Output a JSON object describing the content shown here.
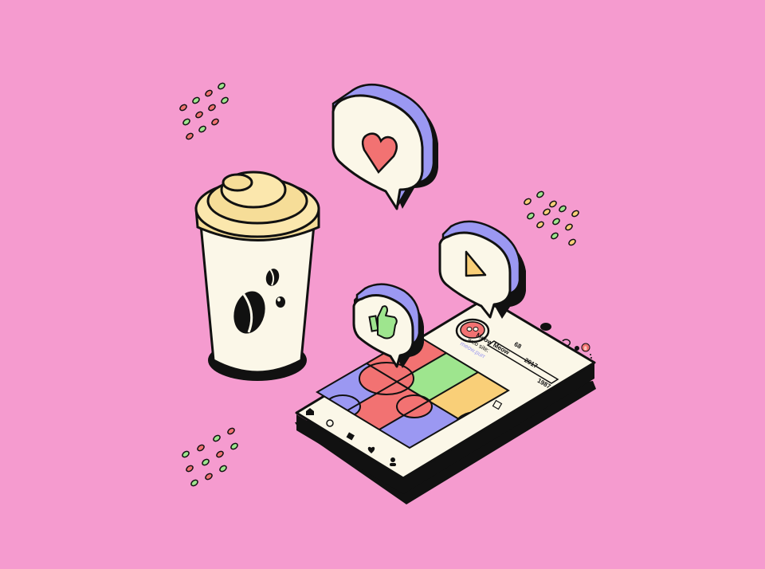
{
  "scene": {
    "background_color": "#f59bcf",
    "accent_colors": {
      "outline": "#111111",
      "cream": "#fbf7e8",
      "lid": "#f6dd98",
      "purple": "#9b98f2",
      "red": "#f27272",
      "green": "#9ee58e",
      "yellow": "#f9cf78"
    }
  },
  "phone": {
    "profile": {
      "name": "Meow Meow",
      "website_label": "web site:",
      "website_value": "meow.purr",
      "stats": [
        "68",
        "2017",
        "1987"
      ],
      "notification_count": "8"
    },
    "nav_icons": [
      "home-icon",
      "search-icon",
      "add-post-icon",
      "heart-icon",
      "profile-icon"
    ],
    "tab_icons": [
      "grid-icon",
      "reels-icon",
      "tagged-icon",
      "saved-icon"
    ]
  },
  "bubbles": [
    {
      "icon": "heart-icon"
    },
    {
      "icon": "play-icon"
    },
    {
      "icon": "thumbs-up-icon"
    }
  ],
  "cup": {
    "icon": "coffee-bean-icon"
  }
}
